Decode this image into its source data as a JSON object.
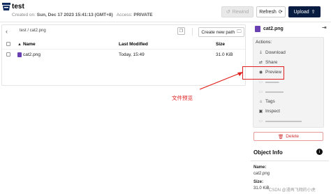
{
  "header": {
    "bucket_name": "test",
    "created_label": "Created on:",
    "created_value": "Sun, Dec 17 2023 15:41:13 (GMT+8)",
    "access_label": "Access:",
    "access_value": "PRIVATE",
    "rewind_label": "Rewind",
    "refresh_label": "Refresh",
    "upload_label": "Upload"
  },
  "browser": {
    "breadcrumb": "test / cat2.png",
    "new_path_label": "Create new path",
    "columns": {
      "name": "Name",
      "modified": "Last Modified",
      "size": "Size"
    },
    "rows": [
      {
        "name": "cat2.png",
        "modified": "Today, 15:49",
        "size": "31.0 KiB"
      }
    ]
  },
  "annotation": {
    "text": "文件预览"
  },
  "object_panel": {
    "file_name": "cat2.png",
    "actions_title": "Actions:",
    "actions": [
      {
        "label": "Download",
        "icon": "download-icon",
        "enabled": true
      },
      {
        "label": "Share",
        "icon": "share-icon",
        "enabled": true
      },
      {
        "label": "Preview",
        "icon": "eye-icon",
        "enabled": true
      },
      {
        "label": "Tags",
        "icon": "tag-icon",
        "enabled": true
      },
      {
        "label": "Inspect",
        "icon": "inspect-icon",
        "enabled": true
      }
    ],
    "delete_label": "Delete",
    "info_title": "Object Info",
    "name_label": "Name:",
    "name_value": "cat2.png",
    "size_label": "Size:",
    "size_value": "31.0 KiB"
  },
  "watermark": "CSDN @漫再飞翔的小虎",
  "colors": {
    "accent": "#081c42",
    "annotation": "#e02020",
    "file_icon": "#6a3fb2",
    "danger": "#d0302f"
  }
}
